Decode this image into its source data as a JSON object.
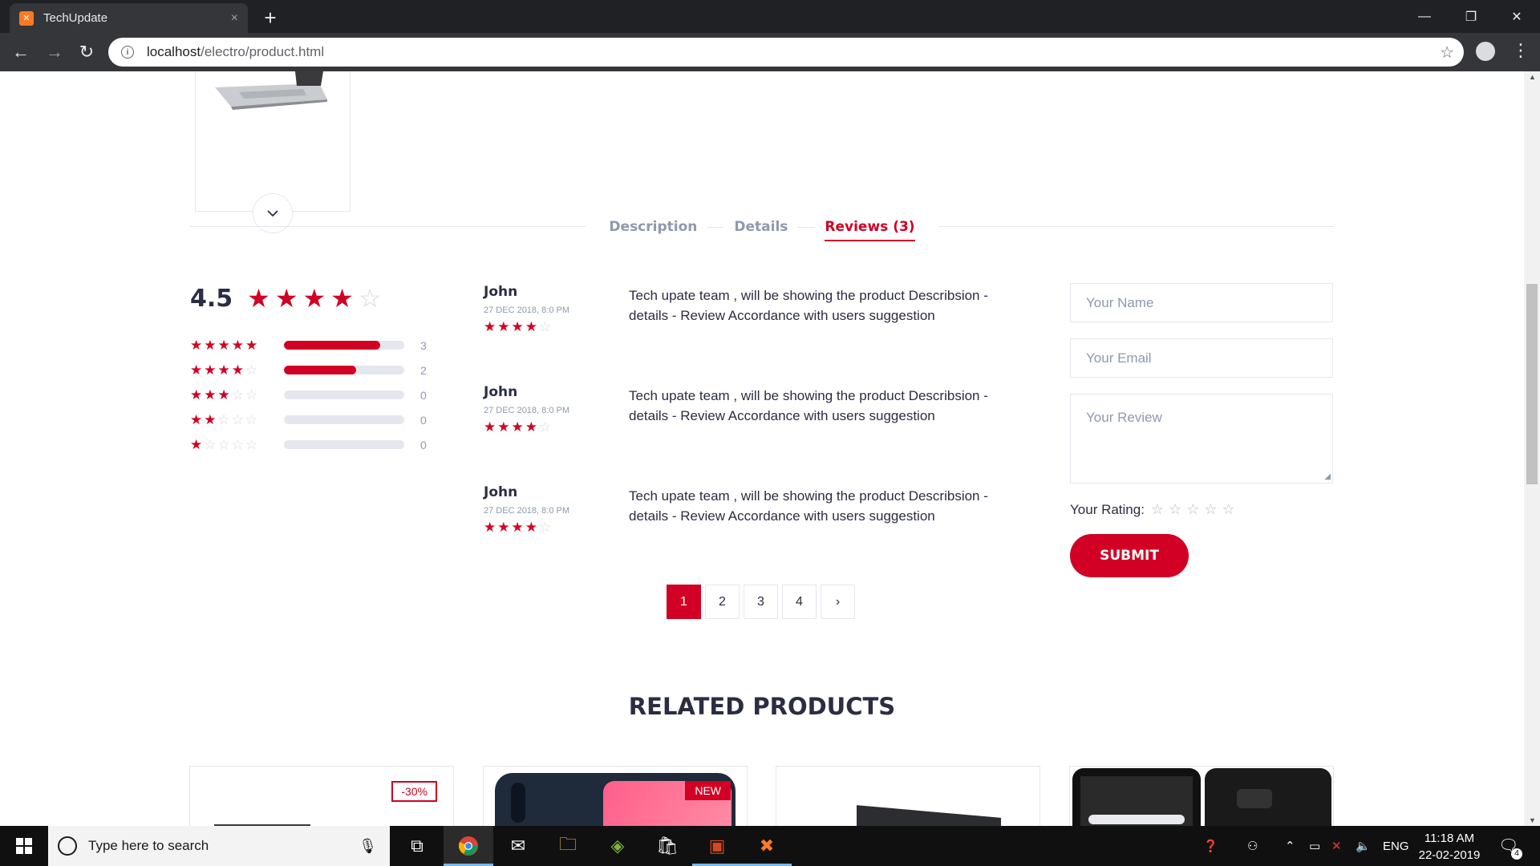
{
  "browser": {
    "tab_title": "TechUpdate",
    "tab_close": "×",
    "new_tab": "+",
    "url_host": "localhost",
    "url_path": "/electro/product.html",
    "window_controls": [
      "—",
      "❐",
      "✕"
    ]
  },
  "gallery": {
    "scroll_down_icon": "chevron-down-icon"
  },
  "tabs": [
    {
      "label": "Description"
    },
    {
      "label": "Details"
    },
    {
      "label": "Reviews (3)",
      "active": true
    }
  ],
  "rating_summary": {
    "average": "4.5",
    "average_stars": 4,
    "rows": [
      {
        "stars": 5,
        "fill": 0.8,
        "count": "3"
      },
      {
        "stars": 4,
        "fill": 0.6,
        "count": "2"
      },
      {
        "stars": 3,
        "fill": 0,
        "count": "0"
      },
      {
        "stars": 2,
        "fill": 0,
        "count": "0"
      },
      {
        "stars": 1,
        "fill": 0,
        "count": "0"
      }
    ]
  },
  "reviews": [
    {
      "name": "John",
      "date": "27 DEC 2018, 8:0 PM",
      "stars": 4,
      "text": "Tech upate team , will be showing the product Describsion - details - Review Accordance with users suggestion"
    },
    {
      "name": "John",
      "date": "27 DEC 2018, 8:0 PM",
      "stars": 4,
      "text": "Tech upate team , will be showing the product Describsion - details - Review Accordance with users suggestion"
    },
    {
      "name": "John",
      "date": "27 DEC 2018, 8:0 PM",
      "stars": 4,
      "text": "Tech upate team , will be showing the product Describsion - details - Review Accordance with users suggestion"
    }
  ],
  "pagination": {
    "pages": [
      "1",
      "2",
      "3",
      "4"
    ],
    "current": "1",
    "next": "›"
  },
  "review_form": {
    "name_placeholder": "Your Name",
    "email_placeholder": "Your Email",
    "review_placeholder": "Your Review",
    "rating_label": "Your Rating:",
    "submit_label": "SUBMIT"
  },
  "related": {
    "title": "RELATED PRODUCTS",
    "products": [
      {
        "badge": "-30%"
      },
      {
        "badge": "NEW"
      },
      {
        "badge": ""
      },
      {
        "badge": ""
      }
    ]
  },
  "taskbar": {
    "search_placeholder": "Type here to search",
    "language": "ENG",
    "time": "11:18 AM",
    "date": "22-02-2019",
    "notification_count": "4"
  },
  "colors": {
    "accent": "#d10024",
    "text": "#2b2d42",
    "muted": "#8d99ae",
    "border": "#e4e7ed"
  }
}
